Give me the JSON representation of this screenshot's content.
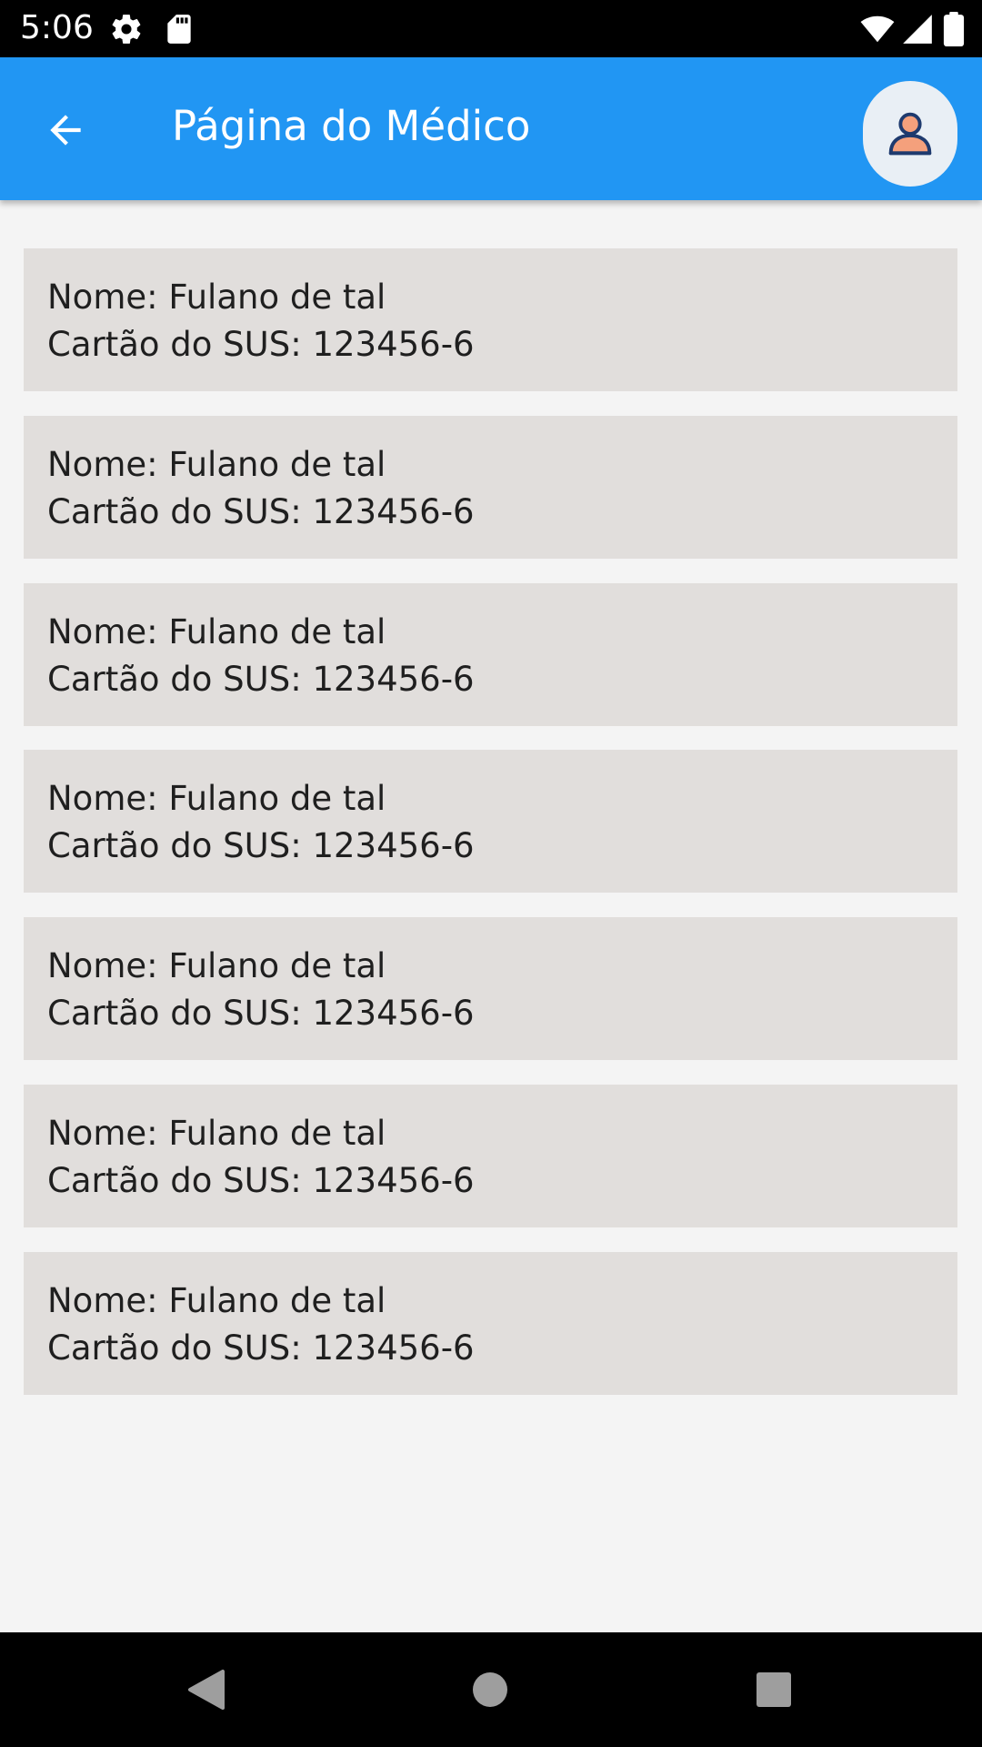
{
  "status_bar": {
    "time": "5:06",
    "icons": [
      "gear-icon",
      "sd-card-icon",
      "wifi-icon",
      "signal-icon",
      "battery-icon"
    ]
  },
  "app_bar": {
    "title": "Página do Médico",
    "back_icon": "arrow-back-icon",
    "avatar_icon": "person-icon",
    "color": "#2196f3"
  },
  "patients": [
    {
      "name": "Nome: Fulano de tal",
      "card": "Cartão do SUS: 123456-6"
    },
    {
      "name": "Nome: Fulano de tal",
      "card": "Cartão do SUS: 123456-6"
    },
    {
      "name": "Nome: Fulano de tal",
      "card": "Cartão do SUS: 123456-6"
    },
    {
      "name": "Nome: Fulano de tal",
      "card": "Cartão do SUS: 123456-6"
    },
    {
      "name": "Nome: Fulano de tal",
      "card": "Cartão do SUS: 123456-6"
    },
    {
      "name": "Nome: Fulano de tal",
      "card": "Cartão do SUS: 123456-6"
    },
    {
      "name": "Nome: Fulano de tal",
      "card": "Cartão do SUS: 123456-6"
    }
  ],
  "nav_bar": {
    "icons": [
      "back-triangle-icon",
      "home-circle-icon",
      "recents-square-icon"
    ]
  }
}
